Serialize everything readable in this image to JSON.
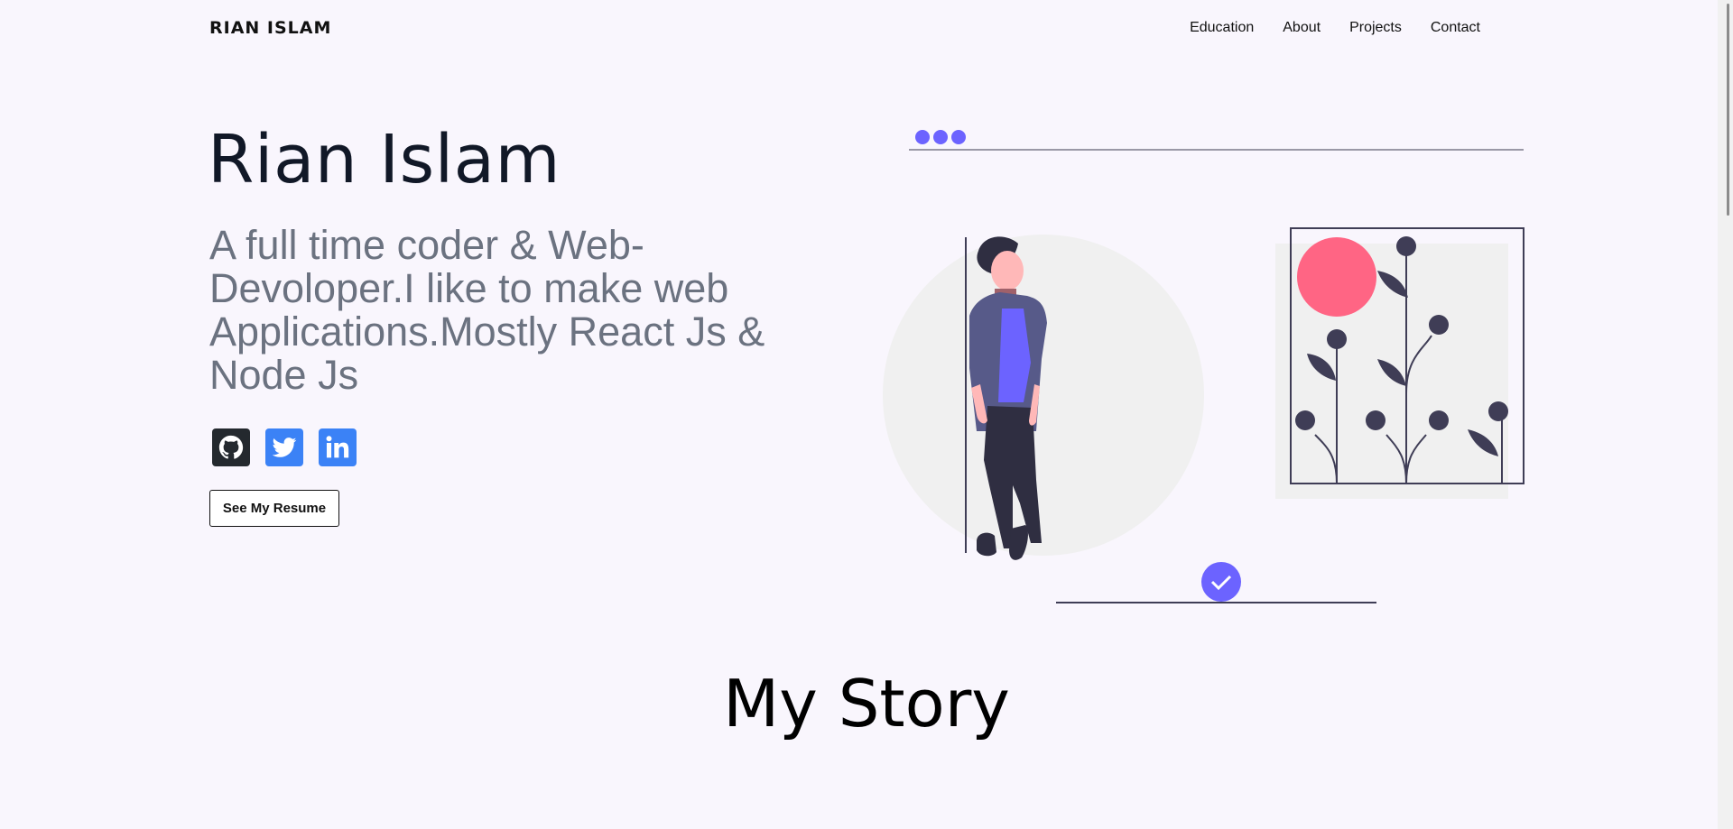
{
  "header": {
    "logo": "Rian Islam",
    "nav": [
      "Education",
      "About",
      "Projects",
      "Contact"
    ]
  },
  "hero": {
    "name": "Rian Islam",
    "tagline": "A full time coder & Web-Devoloper.I like to make web Applications.Mostly React Js & Node Js",
    "socials": [
      {
        "icon": "github-icon"
      },
      {
        "icon": "twitter-icon"
      },
      {
        "icon": "linkedin-icon"
      }
    ],
    "resume_label": "See My Resume"
  },
  "story": {
    "title": "My Story"
  },
  "colors": {
    "background": "#f9f6fd",
    "accent": "#6c63ff",
    "pink": "#ff6584",
    "text_gray": "#6b7280"
  }
}
